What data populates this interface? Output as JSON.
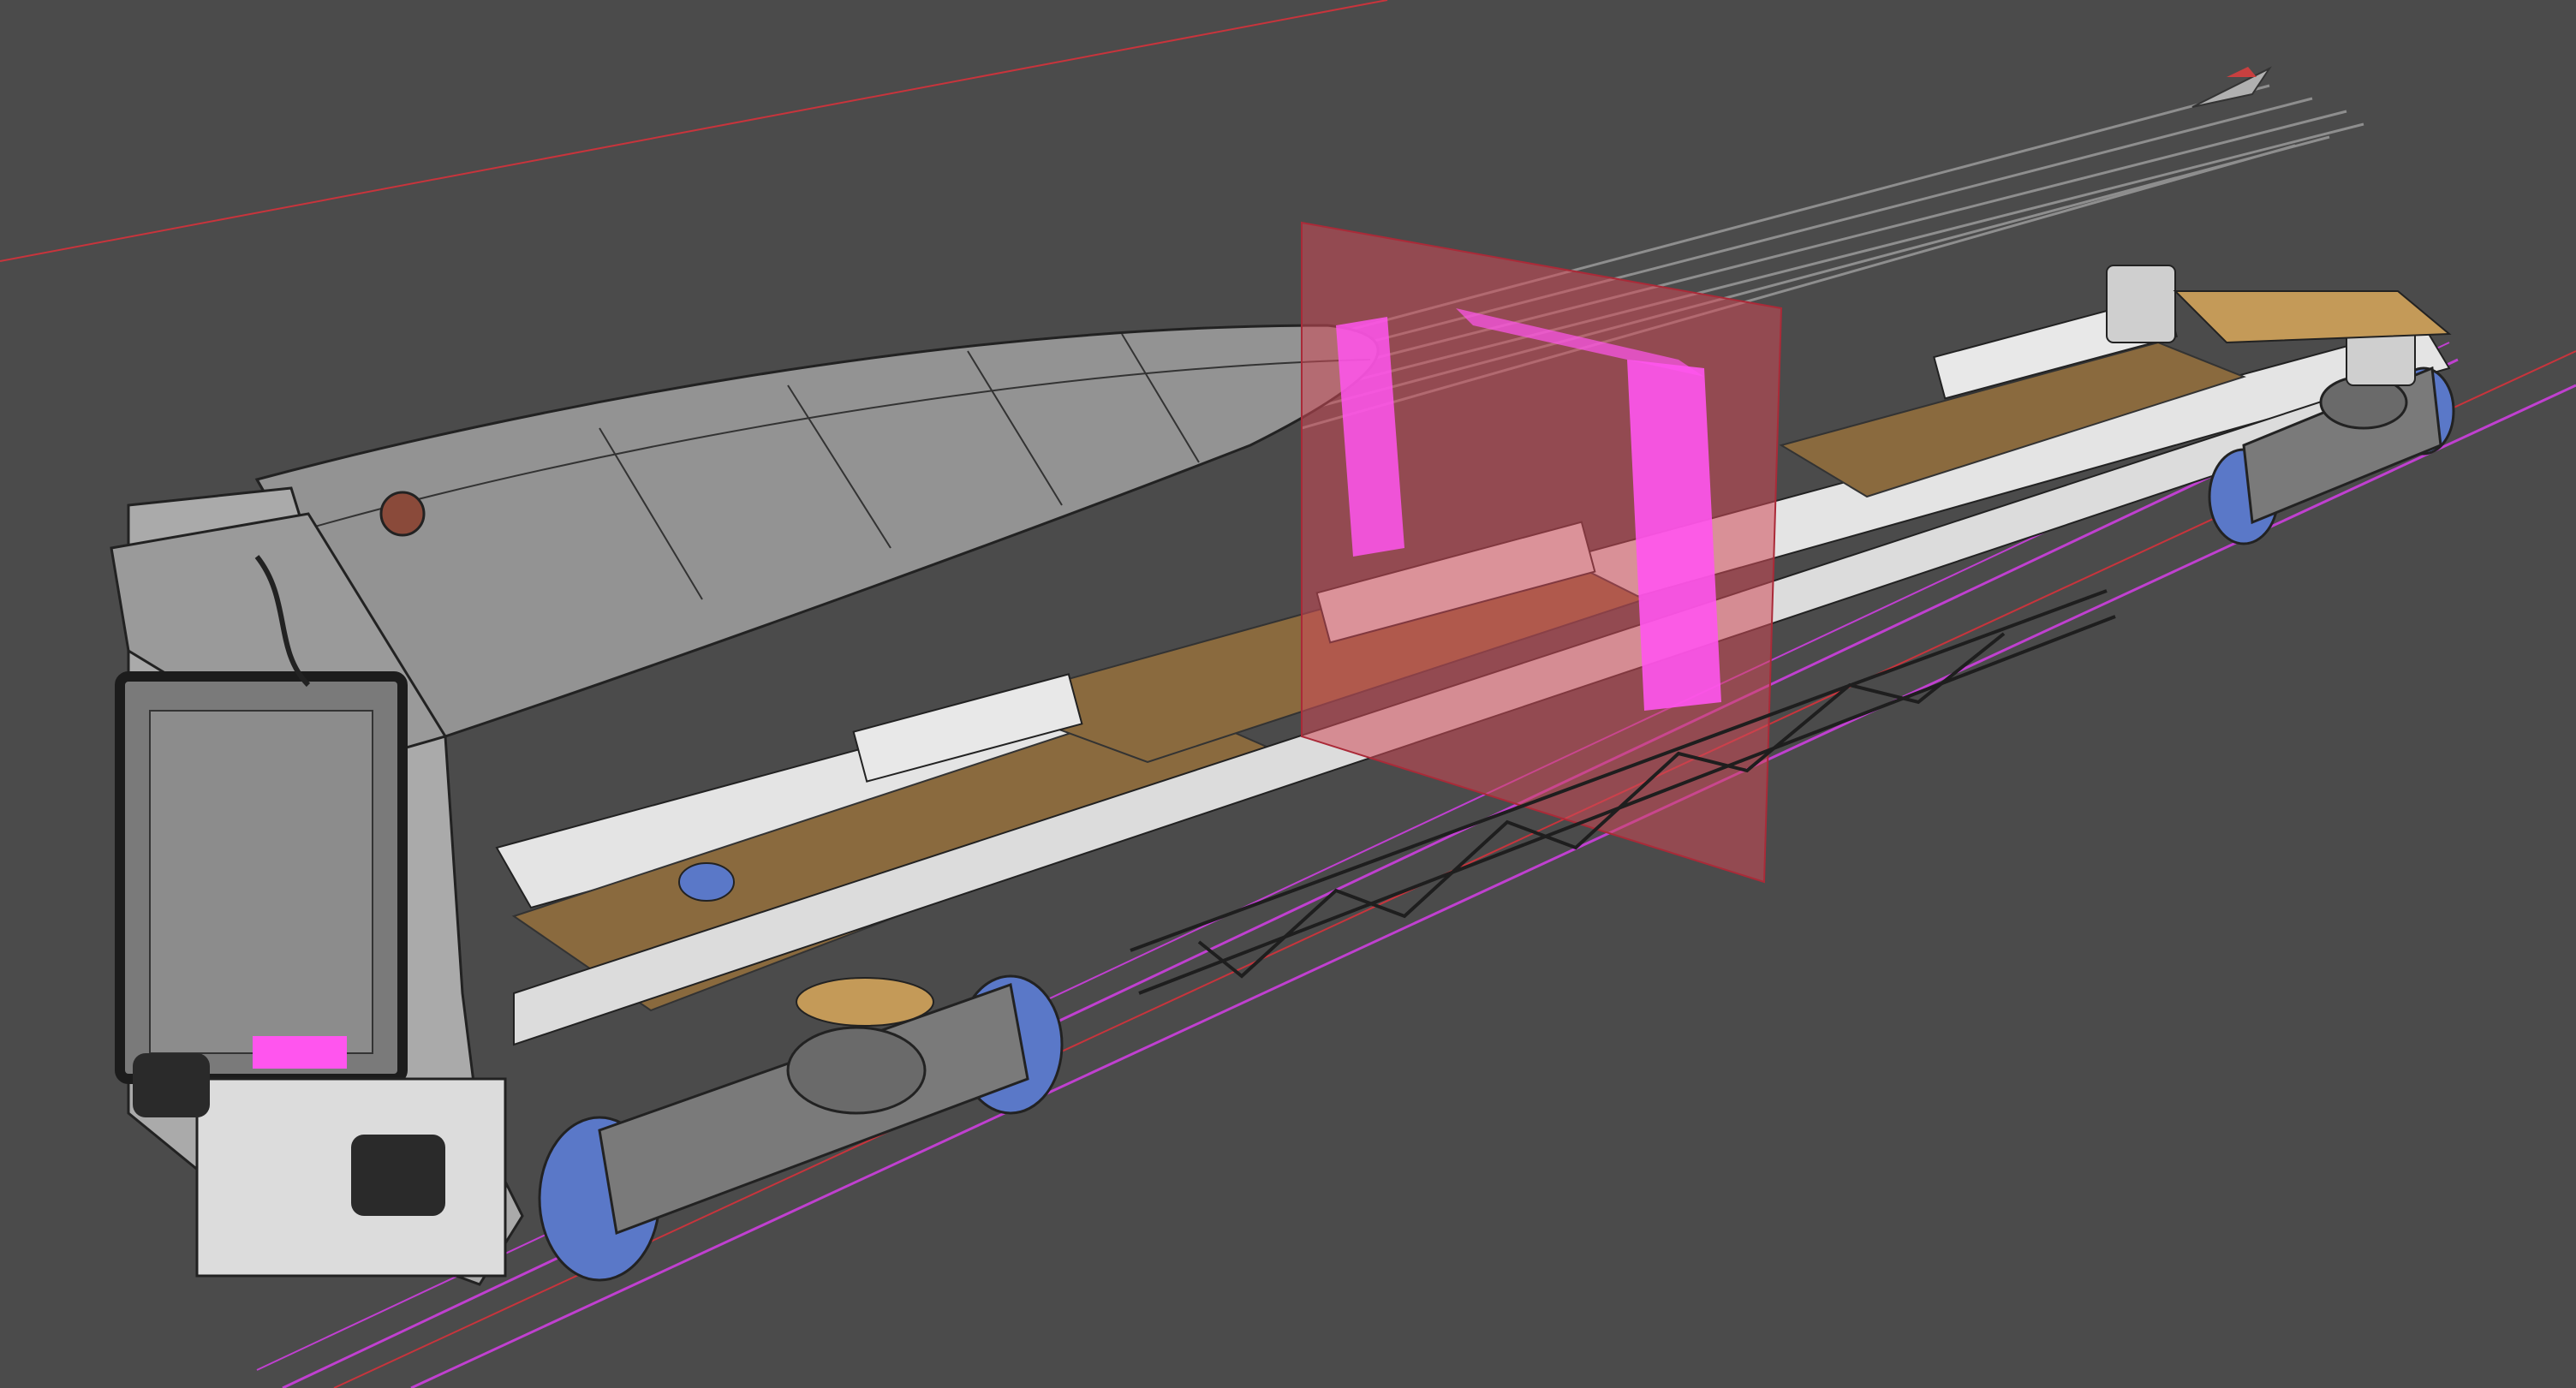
{
  "viewport": {
    "background": "#4b4b4b",
    "axis_x_color": "#c8343c",
    "rail_color": "#c040d0",
    "section_plane_color": "#d04a58",
    "selection_color": "#ff55ee",
    "floor_color": "#8a6a3e",
    "frame_color": "#e4e4e4",
    "bogie_color": "#5a78c8",
    "cab_color": "#8c8c8c",
    "wire_color": "#1e1e1e"
  }
}
